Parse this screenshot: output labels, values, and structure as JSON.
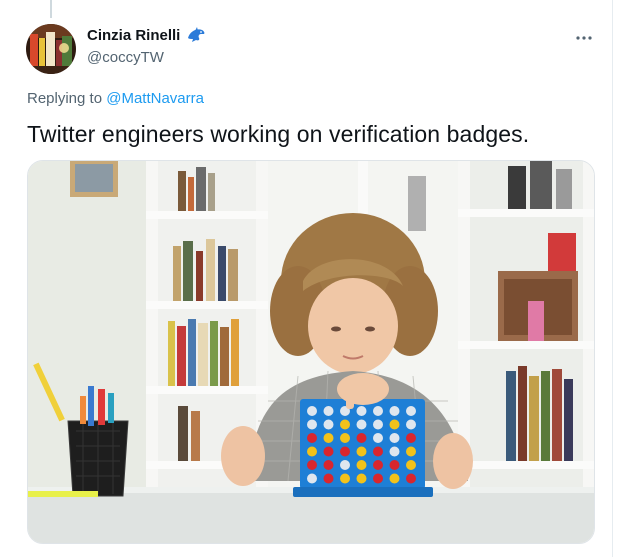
{
  "tweet": {
    "author": {
      "display_name": "Cinzia Rinelli",
      "handle": "@coccyTW",
      "badge_icon": "dolphin-icon"
    },
    "replying_prefix": "Replying to",
    "replying_to": "@MattNavarra",
    "text": "Twitter engineers working on verification badges.",
    "more_icon": "more-horizontal-icon",
    "media": {
      "kind": "photo",
      "subject": "child-playing-connect-four"
    }
  },
  "colors": {
    "text_primary": "#0f1419",
    "text_secondary": "#536471",
    "link": "#1d9bf0",
    "game_board": "#1e7fd6"
  }
}
